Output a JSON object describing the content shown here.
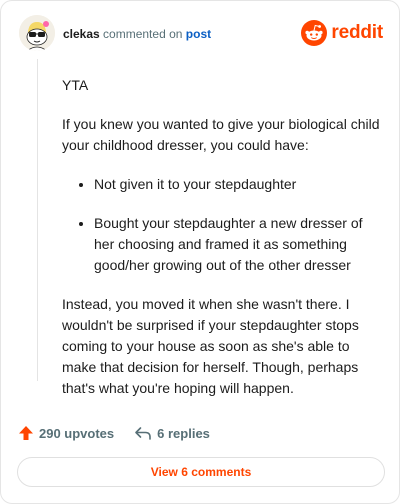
{
  "header": {
    "username": "clekas",
    "action_text": "commented on",
    "post_link": "post",
    "brand_name": "reddit"
  },
  "comment": {
    "verdict": "YTA",
    "para1": "If you knew you wanted to give your biological child your childhood dresser, you could have:",
    "bullets": [
      "Not given it to your stepdaughter",
      "Bought your stepdaughter a new dresser of her choosing and framed it as something good/her growing out of the other dresser"
    ],
    "para2": "Instead, you moved it when she wasn't there. I wouldn't be surprised if your stepdaughter stops coming to your house as soon as she's able to make that decision for herself. Though, perhaps that's what you're hoping will happen."
  },
  "footer": {
    "upvotes": "290 upvotes",
    "replies": "6 replies",
    "view_button": "View 6 comments"
  },
  "colors": {
    "accent": "#ff4500",
    "link": "#0b5fc4",
    "meta": "#576f76"
  }
}
